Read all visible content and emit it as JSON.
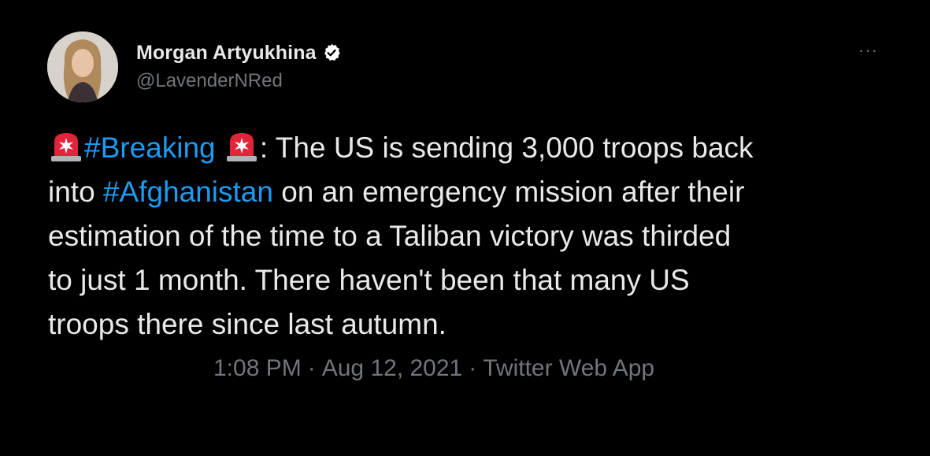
{
  "author": {
    "display_name": "Morgan Artyukhina",
    "handle": "@LavenderNRed",
    "verified": true
  },
  "more_menu": {
    "label": "···"
  },
  "tweet": {
    "line1": {
      "hashtag": "#Breaking",
      "after_siren": ": The US is sending 3,000 troops back"
    },
    "line2": {
      "before": "into ",
      "hashtag": "#Afghanistan",
      "after": " on an emergency mission after their"
    },
    "line3": "estimation of the time to a Taliban victory was thirded",
    "line4": "to just 1 month. There haven't been that many US",
    "line5": "troops there since last autumn."
  },
  "meta": {
    "time": "1:08 PM",
    "separator": "·",
    "date": "Aug 12, 2021",
    "source": "Twitter Web App"
  },
  "colors": {
    "background": "#000000",
    "text": "#e7e9ea",
    "secondary": "#71767b",
    "link": "#1d9bf0",
    "verified_badge": "#ffffff",
    "siren_red": "#e0243a"
  },
  "icons": {
    "siren": "police-car-light-emoji",
    "verified": "verified-badge-icon",
    "more": "more-horizontal-icon"
  }
}
